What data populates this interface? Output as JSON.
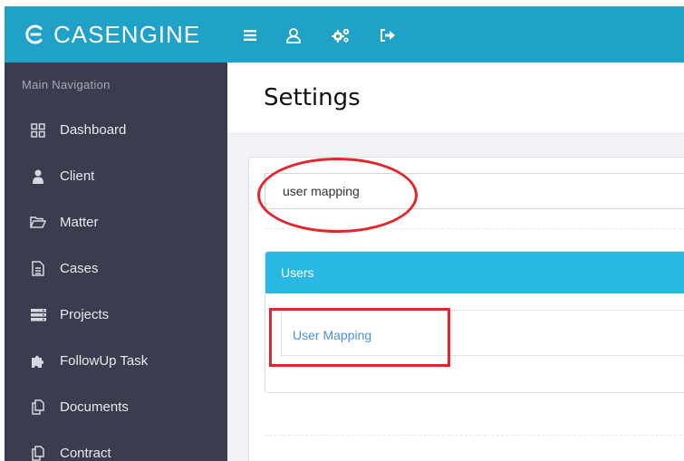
{
  "brand": {
    "name": "CASENGINE"
  },
  "topbar": {
    "icons": [
      {
        "name": "menu-icon"
      },
      {
        "name": "user-icon"
      },
      {
        "name": "settings-gears-icon"
      },
      {
        "name": "logout-icon"
      }
    ]
  },
  "sidebar": {
    "heading": "Main Navigation",
    "items": [
      {
        "label": "Dashboard",
        "icon": "grid-icon"
      },
      {
        "label": "Client",
        "icon": "user-icon"
      },
      {
        "label": "Matter",
        "icon": "folder-open-icon"
      },
      {
        "label": "Cases",
        "icon": "document-icon"
      },
      {
        "label": "Projects",
        "icon": "server-icon"
      },
      {
        "label": "FollowUp Task",
        "icon": "puzzle-icon"
      },
      {
        "label": "Documents",
        "icon": "copy-icon"
      },
      {
        "label": "Contract",
        "icon": "copy-icon"
      }
    ]
  },
  "main": {
    "title": "Settings",
    "search": {
      "value": "user mapping"
    },
    "users_panel": {
      "title": "Users",
      "link": "User Mapping"
    }
  },
  "colors": {
    "topbar": "#1fa1c8",
    "sidebar": "#3a3d4d",
    "panel_header": "#29b8e2",
    "link": "#4a90d9",
    "annotation": "#e2262b"
  }
}
